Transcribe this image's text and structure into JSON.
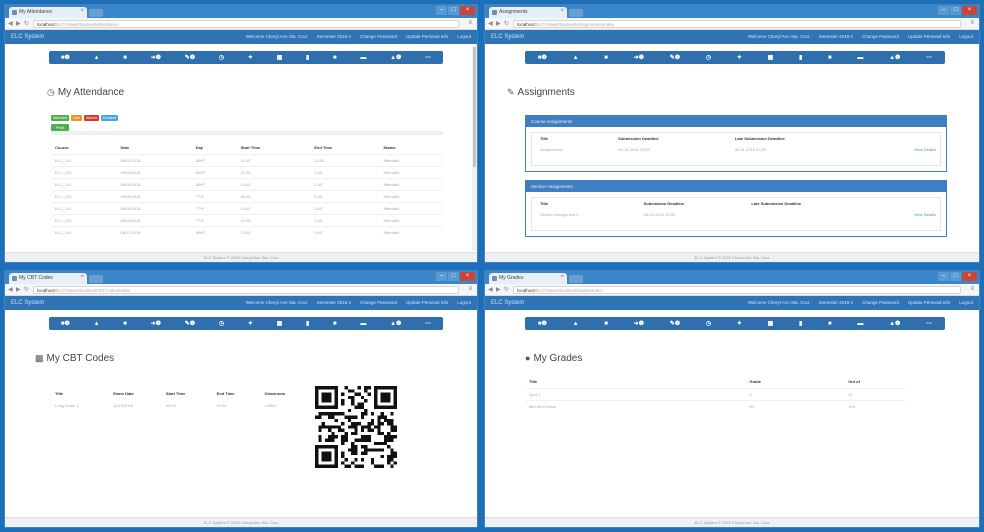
{
  "windows": [
    {
      "tab_title": "My Attendance",
      "url_host": "localhost",
      "url_path": "/ELC/Views/Student/Attendance",
      "brand": "ELC System",
      "links": [
        "Welcome Cheryl Ann Sta. Cruz",
        "Semester 2016-1",
        "Change Password",
        "Update Personal Info",
        "Logout"
      ],
      "page_title": "My Attendance",
      "page_icon": "clock-icon",
      "footer": "ELC System © 2016 Cheryl Ann Sta. Cruz"
    },
    {
      "tab_title": "Assignments",
      "url_host": "localhost",
      "url_path": "/ELC/Views/Student/Assignments/Index",
      "brand": "ELC System",
      "links": [
        "Welcome Cheryl Ann Sta. Cruz",
        "Semester 2016-1",
        "Change Password",
        "Update Personal Info",
        "Logout"
      ],
      "page_title": "Assignments",
      "page_icon": "pencil-icon",
      "footer": "ELC System © 2016 Cheryl Ann Sta. Cruz"
    },
    {
      "tab_title": "My CBT Codes",
      "url_host": "localhost",
      "url_path": "/ELC/Views/Student/CBTCodes/Index",
      "brand": "ELC System",
      "links": [
        "Welcome Cheryl Ann Sta. Cruz",
        "Semester 2016-1",
        "Change Password",
        "Update Personal Info",
        "Logout"
      ],
      "page_title": "My CBT Codes",
      "page_icon": "qr-icon",
      "footer": "ELC System © 2016 Cheryl Ann Sta. Cruz"
    },
    {
      "tab_title": "My Grades",
      "url_host": "localhost",
      "url_path": "/ELC/Views/Student/Grades/Index",
      "brand": "ELC System",
      "links": [
        "Welcome Cheryl Ann Sta. Cruz",
        "Semester 2016-1",
        "Change Password",
        "Update Personal Info",
        "Logout"
      ],
      "page_title": "My Grades",
      "page_icon": "circle-icon",
      "footer": "ELC System © 2016 Cheryl Ann Sta. Cruz"
    }
  ],
  "toolbar_icons": [
    "home-icon",
    "user-icon",
    "book-icon",
    "signin-icon",
    "edit-icon",
    "clock-icon",
    "star-icon",
    "grid-icon",
    "info-icon",
    "file-icon",
    "chat-icon",
    "users-icon",
    "more-icon"
  ],
  "toolbar_glyphs": [
    "■❶",
    "▲",
    "■",
    "➜❶",
    "✎❶",
    "◷",
    "✦",
    "▦",
    "▮",
    "■",
    "▬",
    "▲❶",
    "⋯"
  ],
  "attendance": {
    "badges": [
      "Attended",
      "Late",
      "Absent",
      "Excused"
    ],
    "badge_colors": [
      "#4caf50",
      "#e8961e",
      "#d9382c",
      "#4ea2df"
    ],
    "print_label": "Print",
    "headers": [
      "Course",
      "Date",
      "Day",
      "Start Time",
      "End Time",
      "Status"
    ],
    "rows": [
      [
        "ELC_101",
        "08/01/2016",
        "MWF",
        "11:00",
        "12:00",
        "Attended"
      ],
      [
        "ELC_101",
        "08/03/2016",
        "MWF",
        "11:00",
        "1:00",
        "Attended"
      ],
      [
        "ELC_101",
        "08/05/2016",
        "MWF",
        "14:30",
        "3:30",
        "Attended"
      ],
      [
        "ELC_101",
        "08/08/2016",
        "TTH",
        "08:30",
        "9:30",
        "Attended"
      ],
      [
        "ELC_101",
        "08/09/2016",
        "TTH",
        "10:00",
        "1:00",
        "Attended"
      ],
      [
        "ELC_101",
        "08/10/2016",
        "TTH",
        "10:00",
        "1:00",
        "Attended"
      ],
      [
        "ELC_101",
        "08/12/2016",
        "MWF",
        "13:30",
        "1:00",
        "Attended"
      ]
    ]
  },
  "assignments": {
    "course_panel": {
      "title": "Course Assignments",
      "headers": [
        "Title",
        "Submission Deadline",
        "Late Submission Deadline",
        ""
      ],
      "rows": [
        [
          "Assignment1",
          "08-10-2016 23:59",
          "08-11-2016 23:59",
          "View Details"
        ]
      ]
    },
    "section_panel": {
      "title": "Section Assignments",
      "headers": [
        "Title",
        "Submission Deadline",
        "Late Submission Deadline",
        ""
      ],
      "rows": [
        [
          "Section Assignment 1",
          "08-12-2016 23:59",
          "",
          "View Details"
        ]
      ]
    }
  },
  "cbt": {
    "headers": [
      "Title",
      "Exam Date",
      "Start Time",
      "End Time",
      "Classroom",
      "Building",
      "Code"
    ],
    "rows": [
      [
        "Long Exam 1",
        "11/19/2016",
        "09:00",
        "10:00",
        "LAB01",
        "MGL",
        ""
      ]
    ]
  },
  "grades": {
    "headers": [
      "Title",
      "Grade",
      "Out of"
    ],
    "rows": [
      [
        "Quiz 1",
        "8",
        "10"
      ],
      [
        "Mid-term Exam",
        "80",
        "100"
      ]
    ]
  }
}
